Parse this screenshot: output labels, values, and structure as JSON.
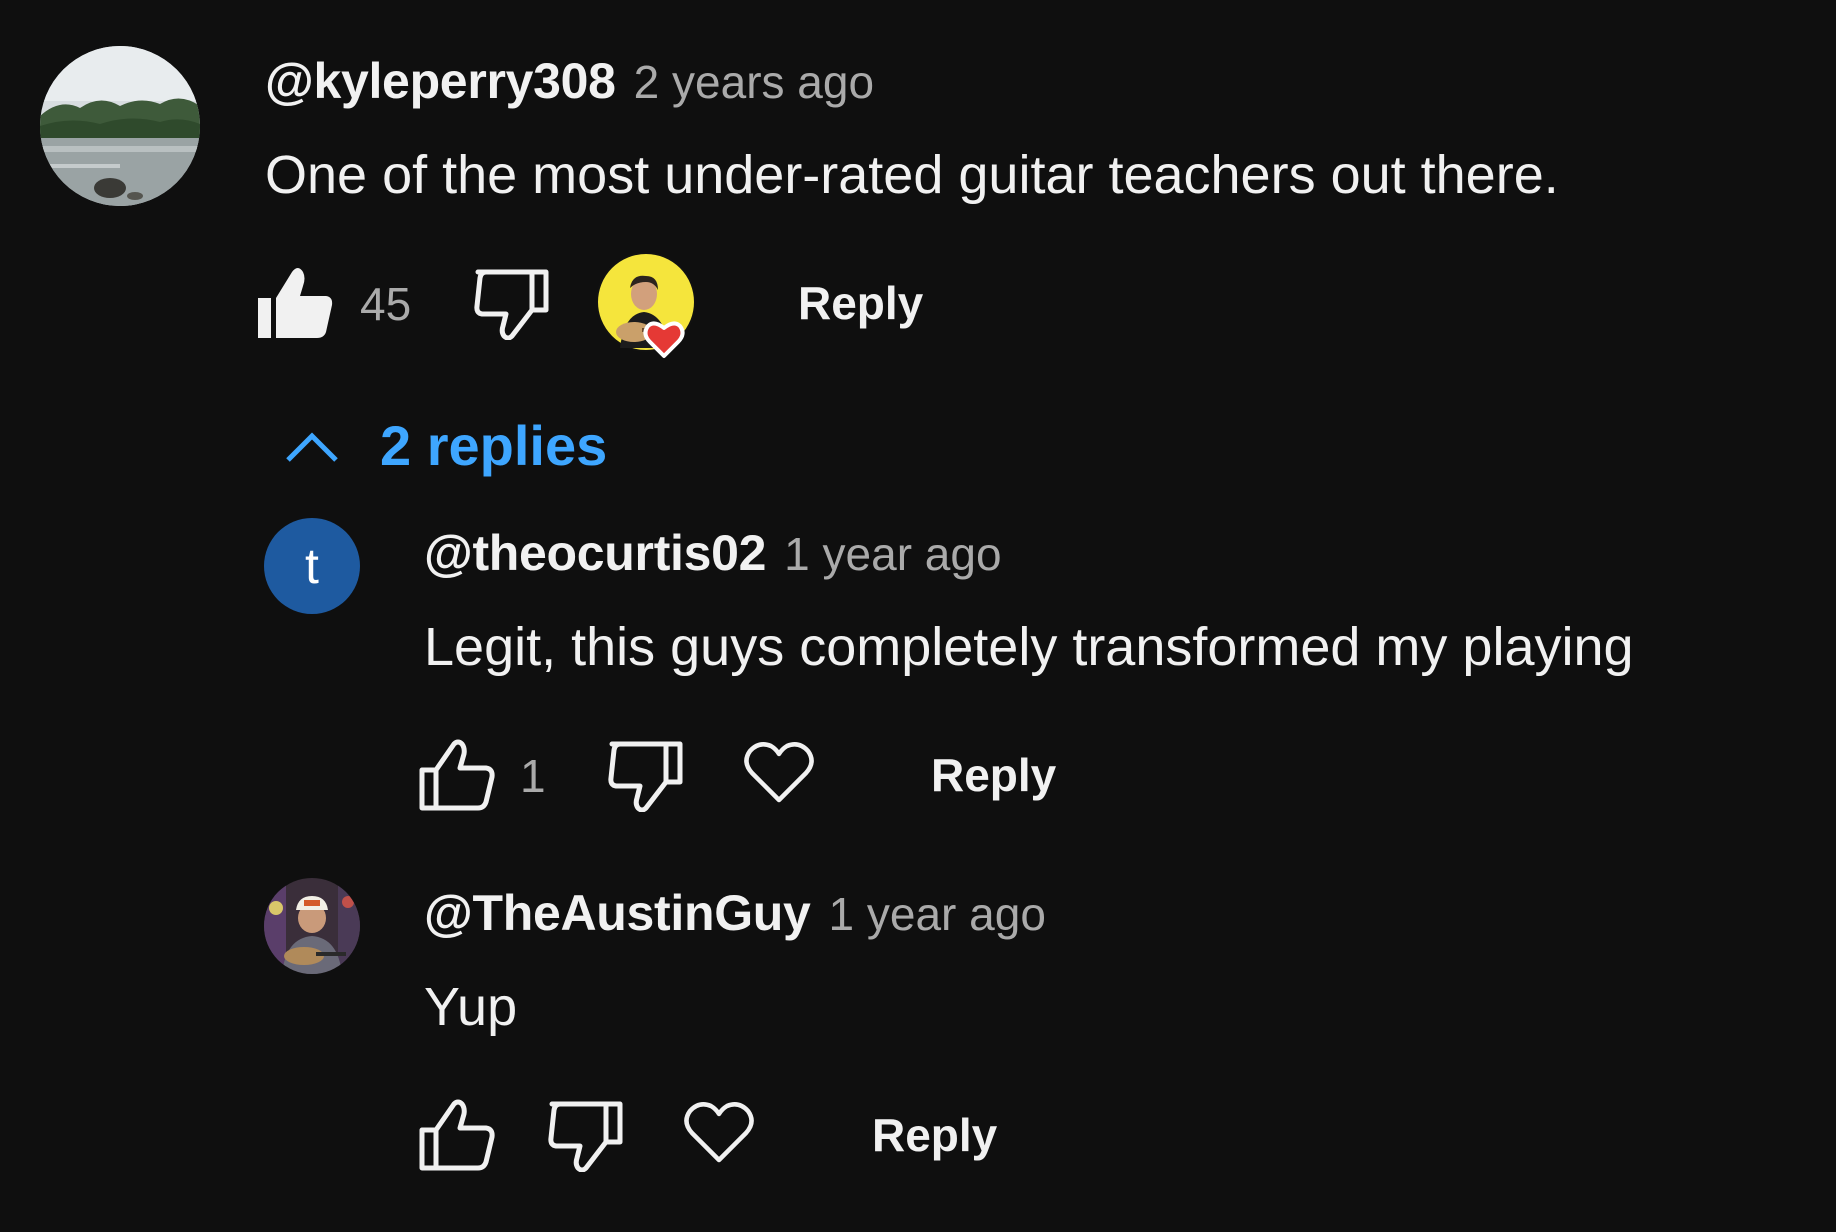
{
  "comment": {
    "author": "@kyleperry308",
    "time": "2 years ago",
    "text": "One of the most under-rated guitar teachers out there.",
    "like_count": "45",
    "reply_label": "Reply",
    "avatar_icon": "lake-landscape-avatar",
    "creator_heart_icon": "creator-heart-badge"
  },
  "replies_toggle": {
    "label": "2 replies",
    "color": "#3ea6ff"
  },
  "replies": [
    {
      "author": "@theocurtis02",
      "time": "1 year ago",
      "text": "Legit, this guys completely transformed my playing",
      "like_count": "1",
      "reply_label": "Reply",
      "avatar_letter": "t",
      "avatar_color": "#1e5aa0"
    },
    {
      "author": "@TheAustinGuy",
      "time": "1 year ago",
      "text": "Yup",
      "reply_label": "Reply",
      "avatar_icon": "photo-avatar"
    }
  ],
  "colors": {
    "background": "#0f0f0f",
    "primary_text": "#f1f1f1",
    "secondary_text": "#aaaaaa",
    "heart": "#e53935",
    "creator_avatar_bg": "#f5e53c"
  }
}
